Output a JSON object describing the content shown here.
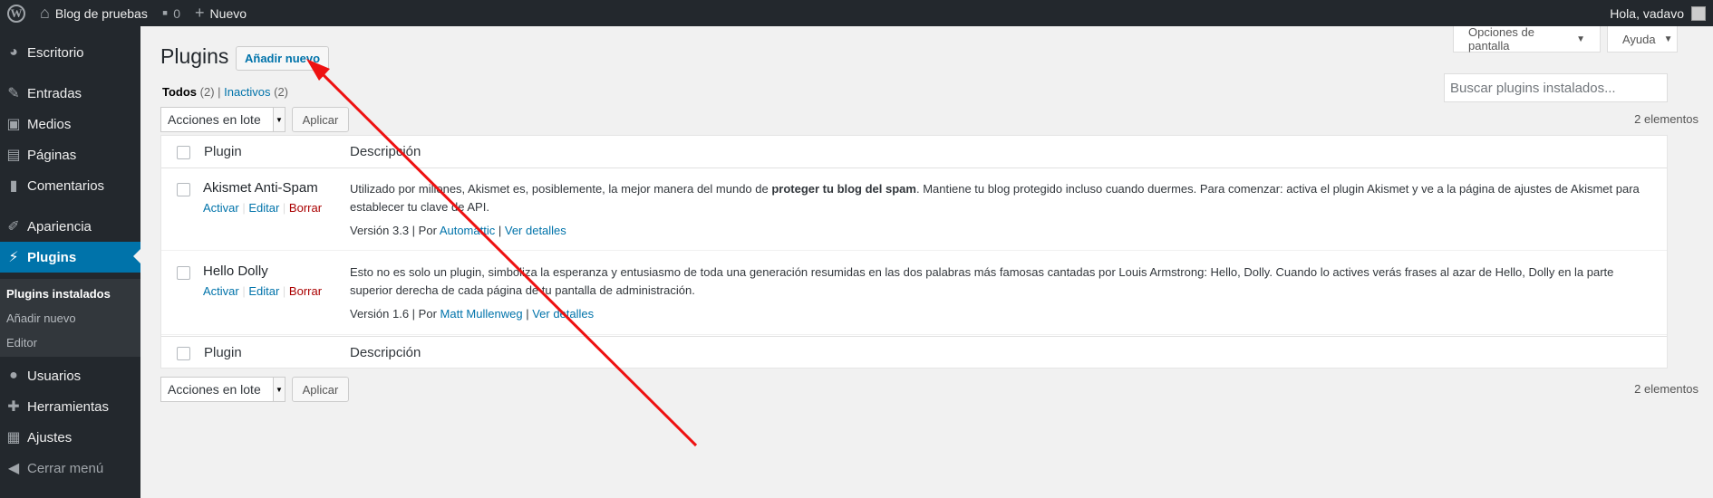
{
  "adminbar": {
    "site_name": "Blog de pruebas",
    "comments_count": "0",
    "new_label": "Nuevo",
    "greeting": "Hola, vadavo"
  },
  "sidebar": {
    "items": [
      {
        "label": "Escritorio",
        "icon": "dashboard-icon"
      },
      {
        "label": "Entradas",
        "icon": "pin-icon"
      },
      {
        "label": "Medios",
        "icon": "media-icon"
      },
      {
        "label": "Páginas",
        "icon": "page-icon"
      },
      {
        "label": "Comentarios",
        "icon": "comment-icon"
      },
      {
        "label": "Apariencia",
        "icon": "brush-icon"
      },
      {
        "label": "Plugins",
        "icon": "plugin-icon"
      },
      {
        "label": "Usuarios",
        "icon": "user-icon"
      },
      {
        "label": "Herramientas",
        "icon": "wrench-icon"
      },
      {
        "label": "Ajustes",
        "icon": "settings-icon"
      }
    ],
    "submenu": [
      "Plugins instalados",
      "Añadir nuevo",
      "Editor"
    ],
    "collapse_label": "Cerrar menú"
  },
  "header": {
    "title": "Plugins",
    "add_new": "Añadir nuevo",
    "screen_options": "Opciones de pantalla",
    "help": "Ayuda"
  },
  "filters": {
    "all_label": "Todos",
    "all_count": "(2)",
    "inactive_label": "Inactivos",
    "inactive_count": "(2)"
  },
  "search": {
    "placeholder": "Buscar plugins instalados..."
  },
  "bulk": {
    "select_label": "Acciones en lote",
    "apply_label": "Aplicar",
    "items_count": "2 elementos"
  },
  "table": {
    "columns": [
      "Plugin",
      "Descripción"
    ],
    "rows": [
      {
        "name": "Akismet Anti-Spam",
        "actions": [
          "Activar",
          "Editar",
          "Borrar"
        ],
        "desc_before": "Utilizado por millones, Akismet es, posiblemente, la mejor manera del mundo de ",
        "desc_bold": "proteger tu blog del spam",
        "desc_after": ". Mantiene tu blog protegido incluso cuando duermes. Para comenzar: activa el plugin Akismet y ve a la página de ajustes de Akismet para establecer tu clave de API.",
        "version": "Versión 3.3",
        "by": "Por",
        "author": "Automattic",
        "details": "Ver detalles"
      },
      {
        "name": "Hello Dolly",
        "actions": [
          "Activar",
          "Editar",
          "Borrar"
        ],
        "desc_before": "Esto no es solo un plugin, simboliza la esperanza y entusiasmo de toda una generación resumidas en las dos palabras más famosas cantadas por Louis Armstrong: Hello, Dolly. Cuando lo actives verás frases al azar de Hello, Dolly en la parte superior derecha de cada página de tu pantalla de administración.",
        "desc_bold": "",
        "desc_after": "",
        "version": "Versión 1.6",
        "by": "Por",
        "author": "Matt Mullenweg",
        "details": "Ver detalles"
      }
    ]
  },
  "colors": {
    "accent": "#0073aa",
    "arrow": "#ee1111"
  }
}
